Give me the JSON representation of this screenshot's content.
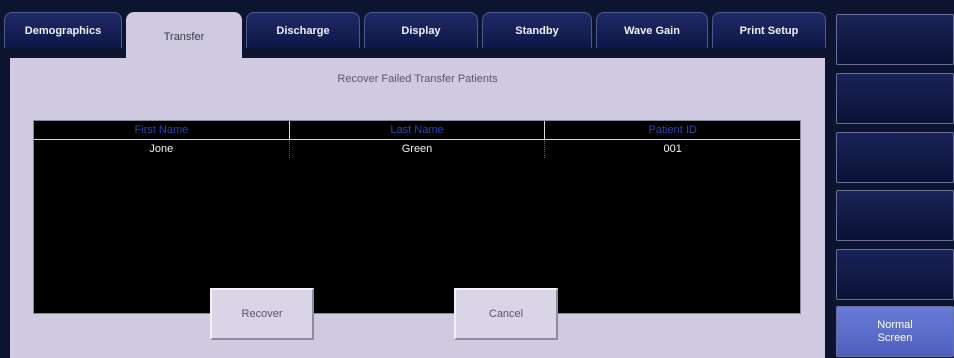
{
  "tabs": [
    {
      "label": "Demographics"
    },
    {
      "label": "Transfer"
    },
    {
      "label": "Discharge"
    },
    {
      "label": "Display"
    },
    {
      "label": "Standby"
    },
    {
      "label": "Wave Gain"
    },
    {
      "label": "Print Setup"
    }
  ],
  "active_tab": "Transfer",
  "panel": {
    "title": "Recover Failed Transfer Patients",
    "columns": [
      "First Name",
      "Last Name",
      "Patient ID"
    ],
    "rows": [
      {
        "first_name": "Jone",
        "last_name": "Green",
        "patient_id": "001"
      }
    ],
    "recover_label": "Recover",
    "cancel_label": "Cancel"
  },
  "side_buttons": [
    {
      "label": ""
    },
    {
      "label": ""
    },
    {
      "label": ""
    },
    {
      "label": ""
    },
    {
      "label": ""
    },
    {
      "label": "Normal\nScreen"
    }
  ],
  "colors": {
    "background": "#0d1430",
    "panel": "#cfcadf",
    "header_text": "#2a44b8",
    "active_side_button": "#5b6cd0"
  }
}
